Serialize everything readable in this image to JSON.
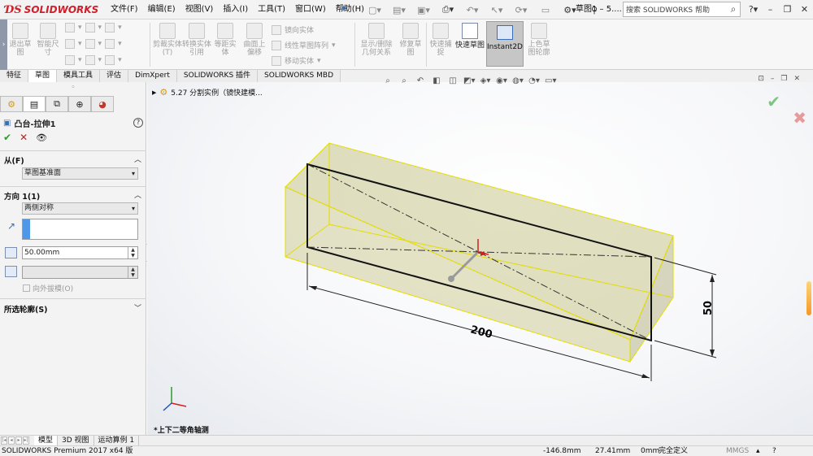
{
  "app": {
    "logo_text": "SOLIDWORKS",
    "doc_title": "草图1 – 5...."
  },
  "menu": [
    "文件(F)",
    "编辑(E)",
    "视图(V)",
    "插入(I)",
    "工具(T)",
    "窗口(W)",
    "帮助(H)"
  ],
  "search": {
    "label": "搜索 SOLIDWORKS 帮助"
  },
  "command_manager": {
    "exit_sketch": "退出草图",
    "smart_dimension": "智能尺寸",
    "trim": "剪裁实体(T)",
    "convert": "转换实体引用",
    "offset": "等距实体",
    "surface_offset": "曲面上偏移",
    "mirror": "镜向实体",
    "linear_pattern": "线性草图阵列",
    "move": "移动实体",
    "display_relations": "显示/删除几何关系",
    "repair": "修复草图",
    "quick_snaps": "快速捕捉",
    "rapid_sketch": "快速草图",
    "instant2d": "Instant2D",
    "shaded_contours": "上色草图轮廓"
  },
  "tabs": [
    "特征",
    "草图",
    "模具工具",
    "评估",
    "DimXpert",
    "SOLIDWORKS 插件",
    "SOLIDWORKS MBD"
  ],
  "active_tab": "草图",
  "property_manager": {
    "feature_name": "凸台-拉伸1",
    "from": {
      "title": "从(F)",
      "value": "草图基准面"
    },
    "direction1": {
      "title": "方向 1(1)",
      "end_condition": "两侧对称",
      "depth": "50.00mm",
      "draft_outward": "向外拔模(O)"
    },
    "selected_contours": "所选轮廓(S)"
  },
  "graphics": {
    "tree_item": "5.27 分割实例（镜快建模...",
    "view_name": "*上下二等角轴测",
    "dim_length": "200",
    "dim_height": "50"
  },
  "bottom_tabs": [
    "模型",
    "3D 视图",
    "运动算例 1"
  ],
  "status": {
    "product": "SOLIDWORKS Premium 2017 x64 版",
    "x": "-146.8mm",
    "y": "27.41mm",
    "z": "0mm",
    "state": "完全定义",
    "units": "MMGS"
  }
}
